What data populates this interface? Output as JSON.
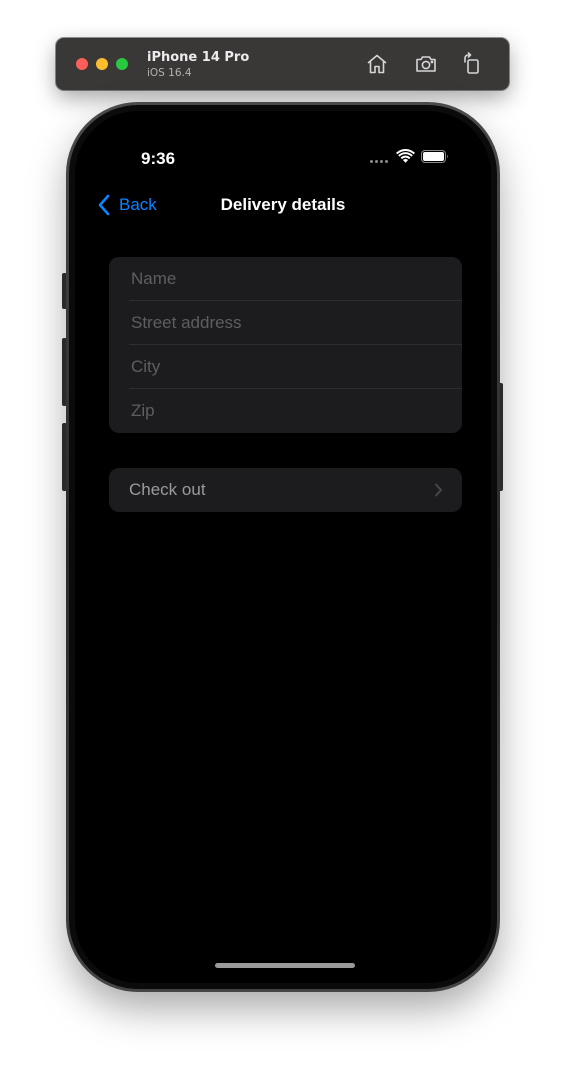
{
  "simulator": {
    "device_name": "iPhone 14 Pro",
    "os_version": "iOS 16.4",
    "toolbar_icons": [
      "home-icon",
      "screenshot-icon",
      "rotate-icon"
    ]
  },
  "status_bar": {
    "time": "9:36",
    "icons": [
      "signal-dots-icon",
      "wifi-icon",
      "battery-icon"
    ]
  },
  "nav": {
    "back_label": "Back",
    "title": "Delivery details"
  },
  "form": {
    "fields": [
      {
        "placeholder": "Name",
        "value": ""
      },
      {
        "placeholder": "Street address",
        "value": ""
      },
      {
        "placeholder": "City",
        "value": ""
      },
      {
        "placeholder": "Zip",
        "value": ""
      }
    ]
  },
  "checkout": {
    "label": "Check out"
  },
  "colors": {
    "accent": "#0a84ff",
    "background": "#000000",
    "group_background": "#1c1c1e",
    "placeholder": "#5e5e62"
  }
}
